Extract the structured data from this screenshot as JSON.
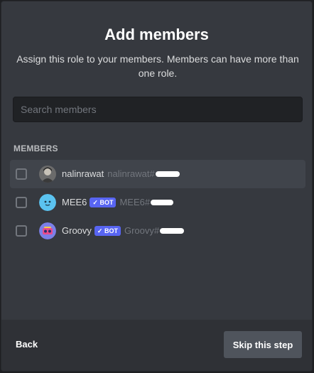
{
  "modal": {
    "title": "Add members",
    "subtitle": "Assign this role to your members. Members can have more than one role."
  },
  "search": {
    "placeholder": "Search members",
    "value": ""
  },
  "members_section": {
    "label": "MEMBERS",
    "members": [
      {
        "name": "nalinrawat",
        "tag": "nalinrawat#",
        "bot": false,
        "checked": false
      },
      {
        "name": "MEE6",
        "tag": "MEE6#",
        "bot": true,
        "badge": "BOT",
        "checked": false
      },
      {
        "name": "Groovy",
        "tag": "Groovy#",
        "bot": true,
        "badge": "BOT",
        "checked": false
      }
    ]
  },
  "footer": {
    "back_label": "Back",
    "skip_label": "Skip this step"
  },
  "colors": {
    "accent": "#5865f2",
    "background": "#36393f",
    "footer": "#2f3136"
  },
  "icons": {
    "checkmark": "check-icon",
    "avatar_user": "user-avatar",
    "avatar_mee6": "mee6-avatar",
    "avatar_groovy": "groovy-avatar"
  }
}
